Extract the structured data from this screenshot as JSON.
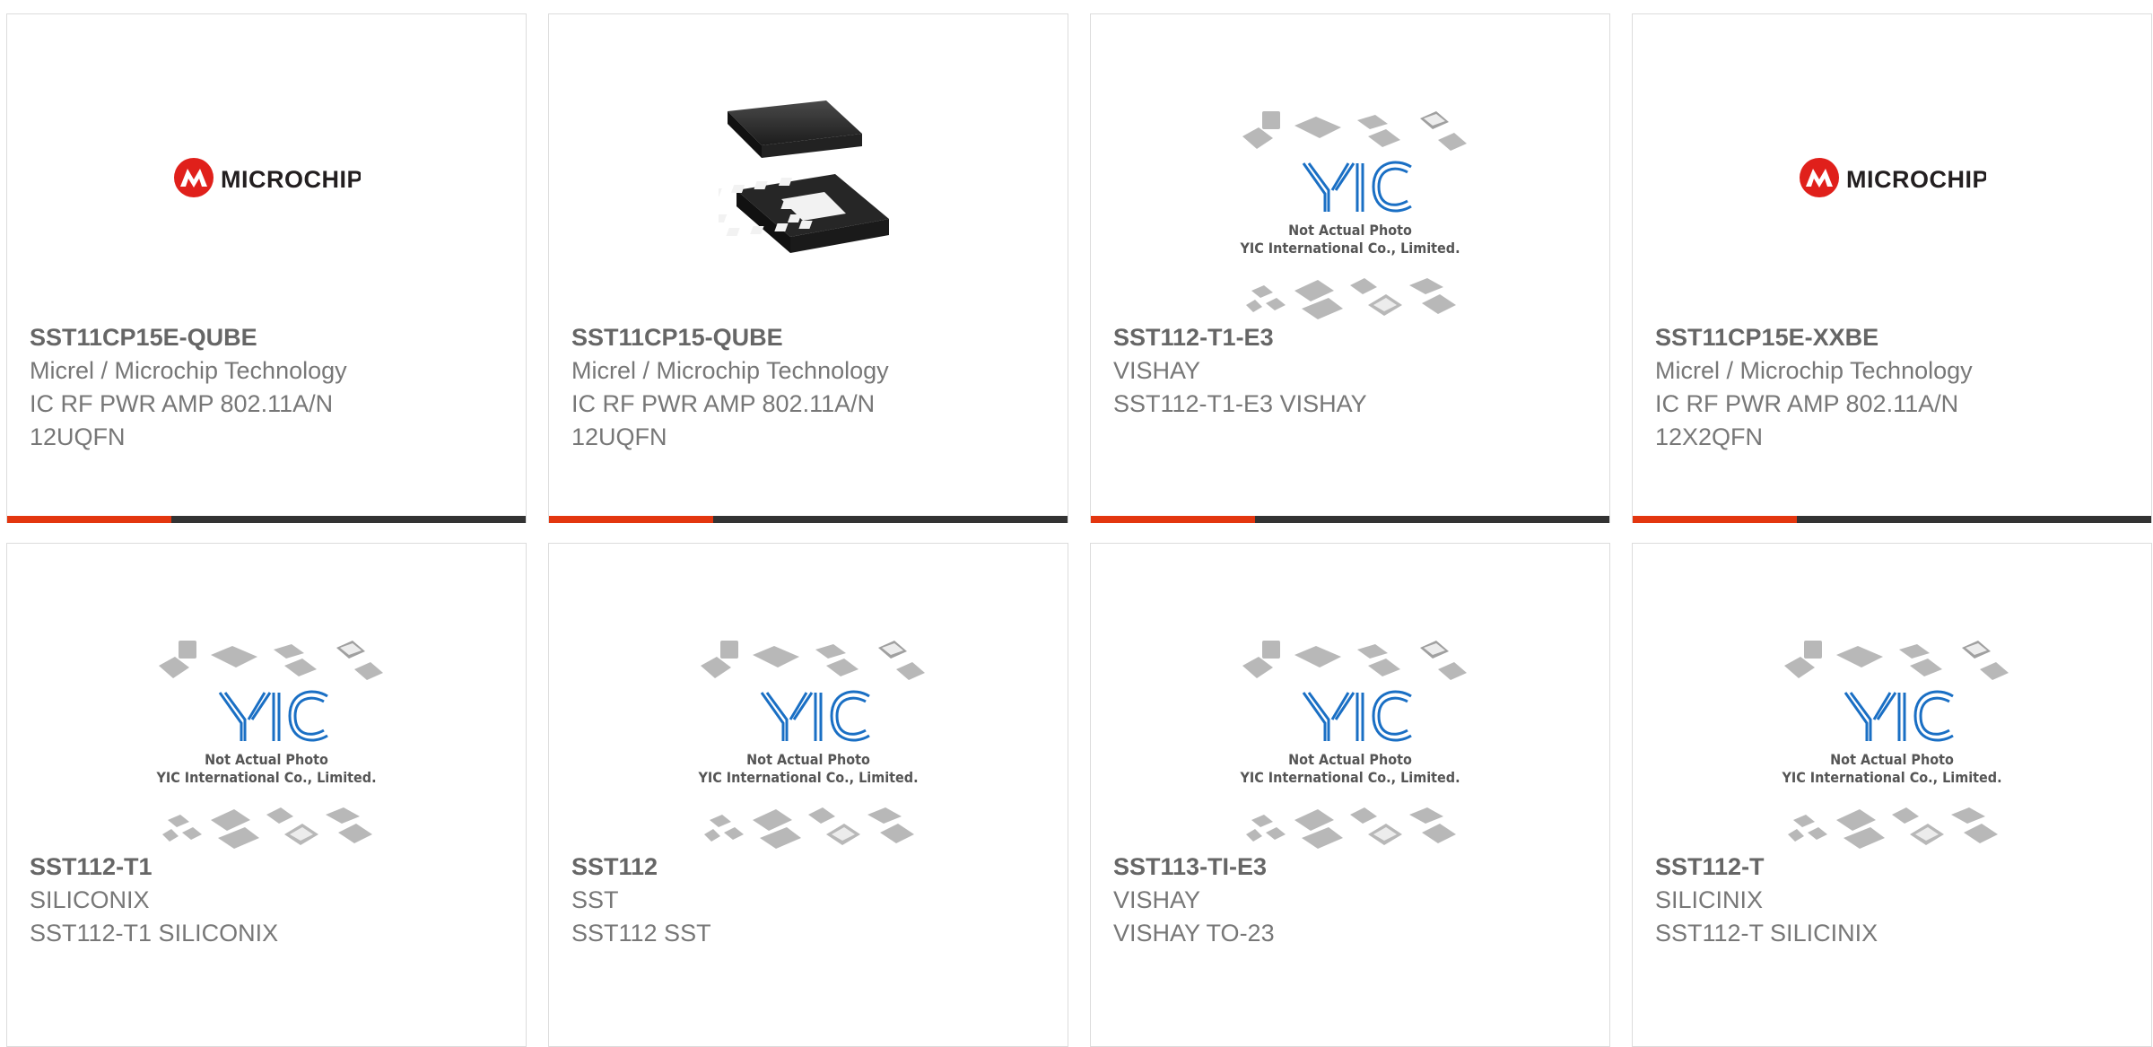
{
  "logo_text": "MICROCHIP",
  "placeholder": {
    "line1": "Not Actual Photo",
    "line2": "YIC International Co., Limited."
  },
  "colors": {
    "accent": "#e3360f",
    "bar": "#333333",
    "microchip_red": "#e0201b",
    "yic_blue": "#1a6fc4"
  },
  "rows": [
    [
      {
        "pn": "SST11CP15E-QUBE",
        "maker": "Micrel / Microchip Technology",
        "desc1": "IC RF PWR AMP 802.11A/N",
        "desc2": "12UQFN",
        "image": "microchip-logo"
      },
      {
        "pn": "SST11CP15-QUBE",
        "maker": "Micrel / Microchip Technology",
        "desc1": "IC RF PWR AMP 802.11A/N",
        "desc2": "12UQFN",
        "image": "qfn-chip"
      },
      {
        "pn": "SST112-T1-E3",
        "maker": "VISHAY",
        "desc1": "SST112-T1-E3 VISHAY",
        "desc2": "",
        "image": "yic-placeholder"
      },
      {
        "pn": "SST11CP15E-XXBE",
        "maker": "Micrel / Microchip Technology",
        "desc1": "IC RF PWR AMP 802.11A/N",
        "desc2": "12X2QFN",
        "image": "microchip-logo"
      }
    ],
    [
      {
        "pn": "SST112-T1",
        "maker": "SILICONIX",
        "desc1": "SST112-T1 SILICONIX",
        "desc2": "",
        "image": "yic-placeholder"
      },
      {
        "pn": "SST112",
        "maker": "SST",
        "desc1": "SST112 SST",
        "desc2": "",
        "image": "yic-placeholder"
      },
      {
        "pn": "SST113-TI-E3",
        "maker": "VISHAY",
        "desc1": "VISHAY TO-23",
        "desc2": "",
        "image": "yic-placeholder"
      },
      {
        "pn": "SST112-T",
        "maker": "SILICINIX",
        "desc1": "SST112-T SILICINIX",
        "desc2": "",
        "image": "yic-placeholder"
      }
    ]
  ]
}
